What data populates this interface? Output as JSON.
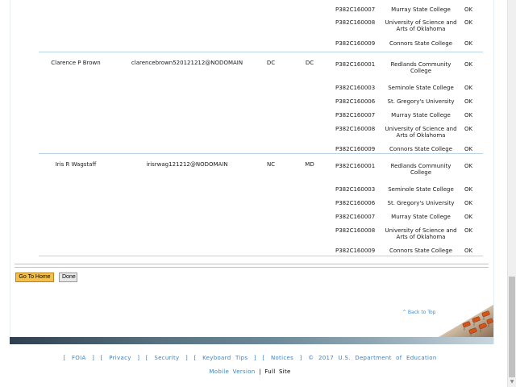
{
  "results": [
    {
      "name": "",
      "email": "",
      "state1": "",
      "state2": "",
      "rows": [
        {
          "code": "P382C160007",
          "school": "Murray State College",
          "status": "OK"
        },
        {
          "code": "P382C160008",
          "school": "University of Science and Arts of Oklahoma",
          "status": "OK"
        },
        {
          "code": "P382C160009",
          "school": "Connors State College",
          "status": "OK"
        }
      ]
    },
    {
      "name": "Clarence P Brown",
      "email": "clarencebrown520121212@NODOMAIN",
      "state1": "DC",
      "state2": "DC",
      "rows": [
        {
          "code": "P382C160001",
          "school": "Redlands Community College",
          "status": "OK"
        },
        {
          "code": "P382C160003",
          "school": "Seminole State College",
          "status": "OK"
        },
        {
          "code": "P382C160006",
          "school": "St. Gregory's University",
          "status": "OK"
        },
        {
          "code": "P382C160007",
          "school": "Murray State College",
          "status": "OK"
        },
        {
          "code": "P382C160008",
          "school": "University of Science and Arts of Oklahoma",
          "status": "OK"
        },
        {
          "code": "P382C160009",
          "school": "Connors State College",
          "status": "OK"
        }
      ]
    },
    {
      "name": "Iris R Wagstaff",
      "email": "irisrwag121212@NODOMAIN",
      "state1": "NC",
      "state2": "MD",
      "rows": [
        {
          "code": "P382C160001",
          "school": "Redlands Community College",
          "status": "OK"
        },
        {
          "code": "P382C160003",
          "school": "Seminole State College",
          "status": "OK"
        },
        {
          "code": "P382C160006",
          "school": "St. Gregory's University",
          "status": "OK"
        },
        {
          "code": "P382C160007",
          "school": "Murray State College",
          "status": "OK"
        },
        {
          "code": "P382C160008",
          "school": "University of Science and Arts of Oklahoma",
          "status": "OK"
        },
        {
          "code": "P382C160009",
          "school": "Connors State College",
          "status": "OK"
        }
      ]
    }
  ],
  "buttons": {
    "go_home": "Go To Home",
    "done": "Done"
  },
  "back_to_top": "^ Back to Top",
  "footer": {
    "foia": "FOIA",
    "privacy": "Privacy",
    "security": "Security",
    "keyboard_tips": "Keyboard Tips",
    "notices": "Notices",
    "copyright": "© 2017 U.S. Department of Education",
    "mobile_version": "Mobile Version",
    "separator": "|",
    "full_site": "Full Site"
  },
  "colors": {
    "link": "#3b82c4",
    "primary_button": "#f5c04a",
    "table_rule": "#bcd4e8"
  }
}
